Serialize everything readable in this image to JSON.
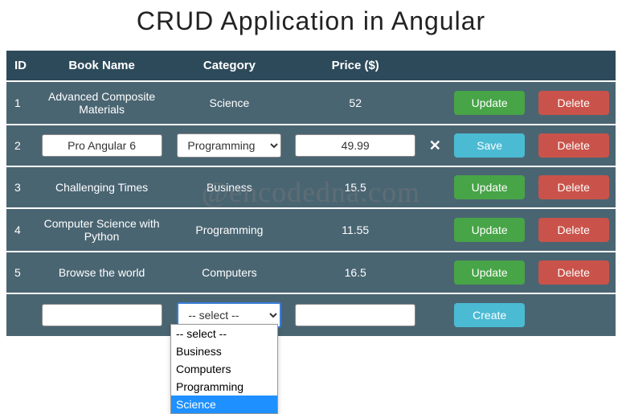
{
  "title": "CRUD Application in Angular",
  "watermark": "@encodedna.com",
  "headers": {
    "id": "ID",
    "name": "Book Name",
    "category": "Category",
    "price": "Price ($)"
  },
  "buttons": {
    "update": "Update",
    "delete": "Delete",
    "save": "Save",
    "create": "Create"
  },
  "close_icon": "✕",
  "rows": [
    {
      "id": "1",
      "name": "Advanced Composite Materials",
      "category": "Science",
      "price": "52"
    },
    {
      "id": "2",
      "name": "Pro Angular 6",
      "category": "Programming",
      "price": "49.99",
      "editing": true
    },
    {
      "id": "3",
      "name": "Challenging Times",
      "category": "Business",
      "price": "15.5"
    },
    {
      "id": "4",
      "name": "Computer Science with Python",
      "category": "Programming",
      "price": "11.55"
    },
    {
      "id": "5",
      "name": "Browse the world",
      "category": "Computers",
      "price": "16.5"
    }
  ],
  "new_row": {
    "name": "",
    "category_display": "-- select --",
    "price": ""
  },
  "dropdown": {
    "placeholder": "-- select --",
    "options": [
      "Business",
      "Computers",
      "Programming",
      "Science"
    ],
    "selected": "Science"
  }
}
